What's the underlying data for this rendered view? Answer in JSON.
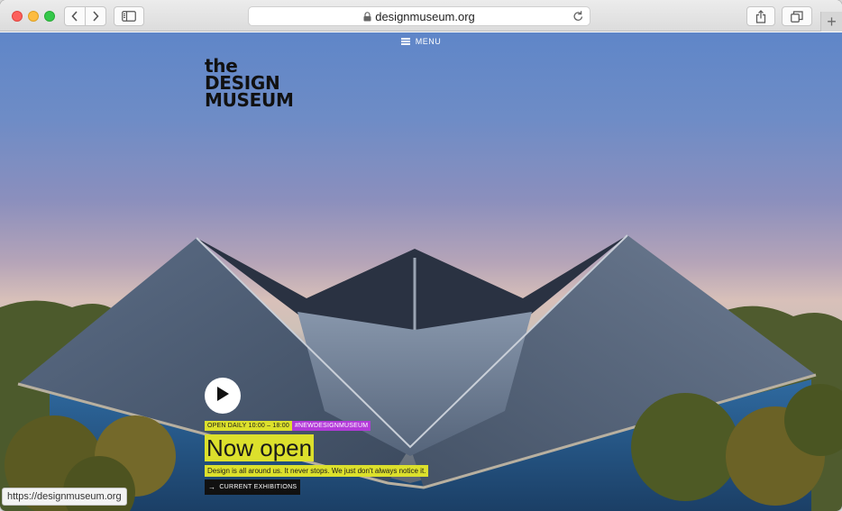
{
  "browser": {
    "url": "designmuseum.org",
    "status_url": "https://designmuseum.org",
    "new_tab": "+"
  },
  "site": {
    "menu_label": "MENU",
    "logo_lines": [
      "the",
      "DESIGN",
      "MUSEUM"
    ],
    "hours_tag": "OPEN DAILY 10:00 – 18:00",
    "hashtag": "#NEWDESIGNMUSEUM",
    "headline": "Now open",
    "subline": "Design is all around us. It never stops. We just don't always notice it.",
    "exhibitions_label": "CURRENT EXHIBITIONS",
    "arrow": "→"
  },
  "colors": {
    "highlight": "#dce02c",
    "hashtag_bg": "#b33ad9"
  },
  "icons": {
    "back": "chevron-left-icon",
    "forward": "chevron-right-icon",
    "sidebar": "sidebar-icon",
    "lock": "lock-icon",
    "reload": "reload-icon",
    "share": "share-icon",
    "tabs": "tabs-icon",
    "play": "play-icon",
    "menu": "hamburger-icon"
  }
}
